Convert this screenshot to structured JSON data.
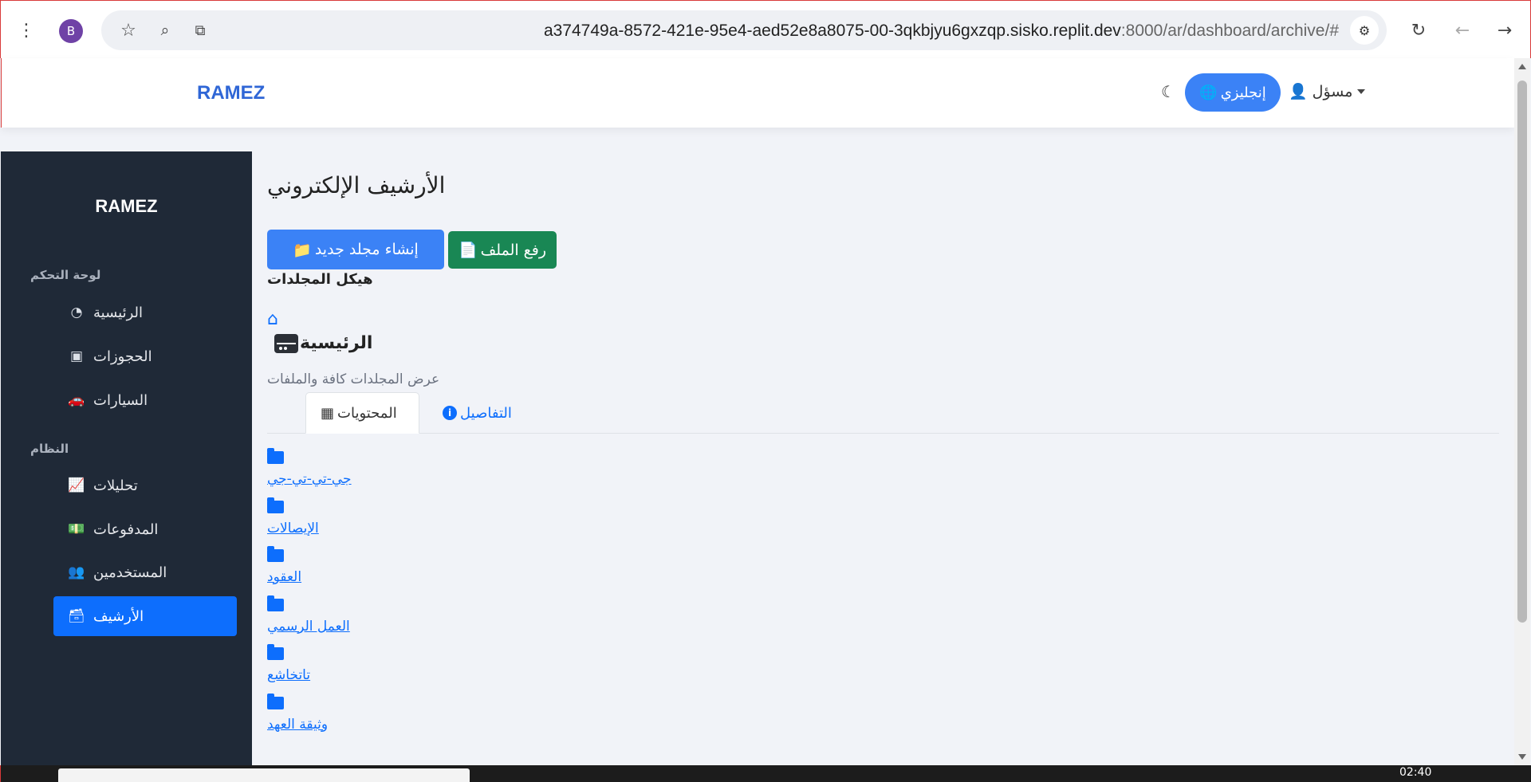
{
  "browser": {
    "profile_initial": "B",
    "url_main": "a374749a-8572-421e-95e4-aed52e8a8075-00-3qkbjyu6gxzqp.sisko.replit.dev",
    "url_rest": ":8000/ar/dashboard/archive/#",
    "icons": [
      "menu-dots-icon",
      "star-icon",
      "zoom-icon",
      "translate-icon",
      "site-settings-icon",
      "reload-icon",
      "back-icon",
      "forward-icon"
    ]
  },
  "topbar": {
    "brand": "RAMEZ",
    "language_button": "إنجليزي",
    "user_label": "مسؤل"
  },
  "sidebar": {
    "brand": "RAMEZ",
    "section_dashboard": "لوحة التحكم",
    "section_system": "النظام",
    "items": [
      {
        "label": "الرئيسية",
        "icon": "gauge-icon"
      },
      {
        "label": "الحجوزات",
        "icon": "calendar-check-icon"
      },
      {
        "label": "السيارات",
        "icon": "car-icon"
      },
      {
        "label": "تحليلات",
        "icon": "chart-line-icon"
      },
      {
        "label": "المدفوعات",
        "icon": "money-icon"
      },
      {
        "label": "المستخدمين",
        "icon": "users-icon"
      },
      {
        "label": "الأرشيف",
        "icon": "archive-icon",
        "active": true
      }
    ]
  },
  "main": {
    "page_title": "الأرشيف الإلكتروني",
    "new_folder_button": "إنشاء مجلد جديد",
    "upload_button": "رفع الملف",
    "structure_title": "هيكل المجلدات",
    "current_folder": "الرئيسية",
    "folder_description": "عرض المجلدات كافة والملفات",
    "tab_contents": "المحتويات",
    "tab_details": "التفاصيل",
    "folders": [
      "جي-تي-تي-جي",
      "الإيصالات",
      "العقود",
      "العمل الرسمي",
      "تاتخاشع",
      "وثيقة العهد"
    ]
  },
  "taskbar": {
    "time": "02:40"
  },
  "colors": {
    "primary": "#0d6efd",
    "sidebar_bg": "#1f2937",
    "success": "#198754",
    "language_button": "#3b82f6"
  }
}
